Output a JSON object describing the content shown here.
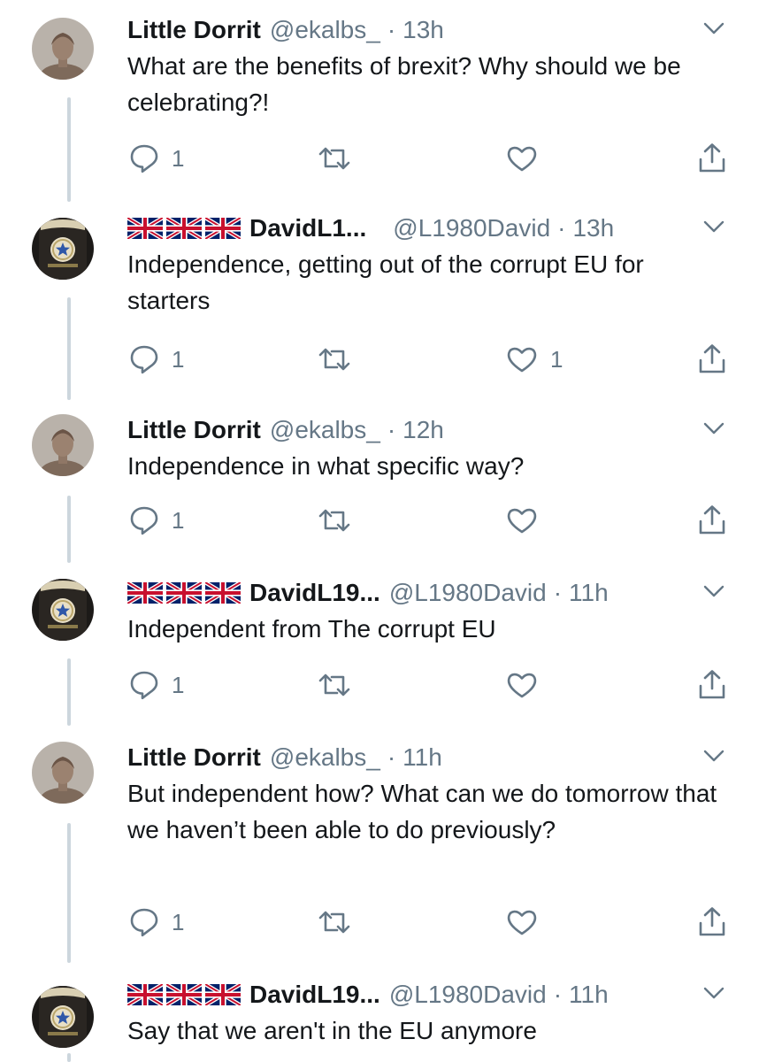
{
  "tweets": [
    {
      "name": "Little Dorrit",
      "handle": "@ekalbs_",
      "time": "13h",
      "has_flags": false,
      "avatar": "bust-portrait",
      "text": "What are the benefits of brexit? Why should we be celebrating?!",
      "replies": "1",
      "retweets": "",
      "likes": ""
    },
    {
      "name": "DavidL1...",
      "handle": "@L1980David",
      "time": "13h",
      "has_flags": true,
      "avatar": "pint-glass",
      "text": "Independence, getting out of the corrupt EU for starters",
      "replies": "1",
      "retweets": "",
      "likes": "1"
    },
    {
      "name": "Little Dorrit",
      "handle": "@ekalbs_",
      "time": "12h",
      "has_flags": false,
      "avatar": "bust-portrait",
      "text": "Independence in what specific way?",
      "replies": "1",
      "retweets": "",
      "likes": ""
    },
    {
      "name": "DavidL19...",
      "handle": "@L1980David",
      "time": "11h",
      "has_flags": true,
      "avatar": "pint-glass",
      "text": "Independent from The corrupt EU",
      "replies": "1",
      "retweets": "",
      "likes": ""
    },
    {
      "name": "Little Dorrit",
      "handle": "@ekalbs_",
      "time": "11h",
      "has_flags": false,
      "avatar": "bust-portrait",
      "text": "But independent how? What can we do tomorrow that we haven’t been able to do previously?",
      "replies": "1",
      "retweets": "",
      "likes": ""
    },
    {
      "name": "DavidL19...",
      "handle": "@L1980David",
      "time": "11h",
      "has_flags": true,
      "avatar": "pint-glass",
      "text": "Say that we aren't in the EU anymore",
      "replies": "",
      "retweets": "",
      "likes": ""
    }
  ],
  "dot": "·",
  "icons": {
    "reply": "reply-icon",
    "retweet": "retweet-icon",
    "like": "heart-icon",
    "share": "share-icon",
    "menu": "chevron-down-icon",
    "flag": "union-jack-flag-icon"
  },
  "colors": {
    "text": "#14171a",
    "secondary": "#657786",
    "thread_line": "#ccd6dd",
    "flag_blue": "#012169",
    "flag_red": "#c8102e"
  }
}
